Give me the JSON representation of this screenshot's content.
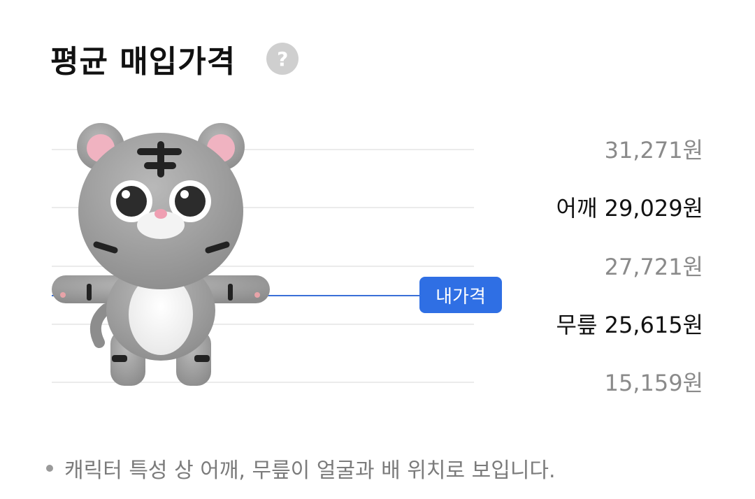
{
  "header": {
    "title": "평균 매입가격",
    "help_icon": "question-circle-icon",
    "help_glyph": "?"
  },
  "colors": {
    "accent": "#2f6fe4",
    "grid": "#ebebeb",
    "muted": "#8a8a8a"
  },
  "price_levels": [
    {
      "prefix": "",
      "price": "31,271원",
      "emphasis": false
    },
    {
      "prefix": "어깨",
      "price": "29,029원",
      "emphasis": true
    },
    {
      "prefix": "",
      "price": "27,721원",
      "emphasis": false
    },
    {
      "prefix": "무릎",
      "price": "25,615원",
      "emphasis": true
    },
    {
      "prefix": "",
      "price": "15,159원",
      "emphasis": false
    }
  ],
  "my_price": {
    "tag_label": "내가격"
  },
  "character": {
    "icon": "tiger-character-icon"
  },
  "footer": {
    "note": "캐릭터 특성 상 어깨, 무릎이 얼굴과 배 위치로 보입니다."
  }
}
